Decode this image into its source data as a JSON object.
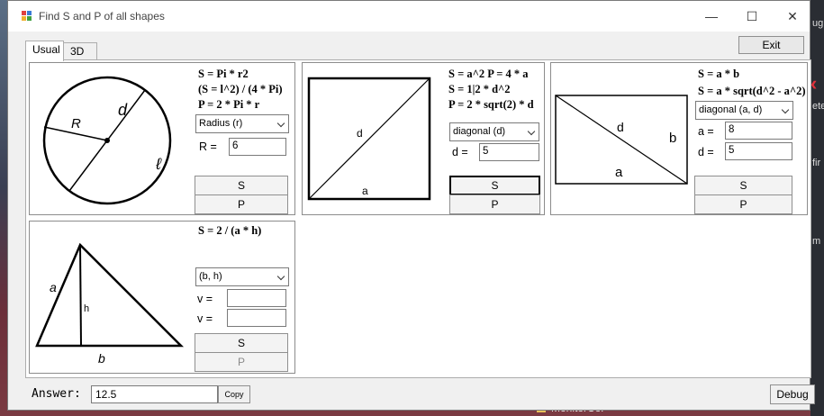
{
  "window": {
    "title": "Find S and P of all shapes",
    "minimize": "—",
    "maximize": "☐",
    "close": "✕"
  },
  "tabs": [
    {
      "label": "Usual",
      "active": true
    },
    {
      "label": "3D",
      "active": false
    }
  ],
  "circle": {
    "formulas": [
      "S = Pi * r2",
      "(S = l^2) / (4 * Pi)",
      "P = 2 * Pi * r"
    ],
    "select": "Radius (r)",
    "fields": [
      {
        "label": "R  =",
        "value": "6"
      }
    ],
    "buttons": [
      "S",
      "P"
    ],
    "diagram_labels": {
      "radius": "R",
      "diameter": "d",
      "perimeter": "ℓ"
    }
  },
  "square": {
    "formulas": [
      "S = a^2   P = 4 * a",
      "S = 1|2 * d^2",
      "P = 2 * sqrt(2) * d"
    ],
    "select": "diagonal (d)",
    "fields": [
      {
        "label": "d  =",
        "value": "5"
      }
    ],
    "buttons": [
      "S",
      "P"
    ],
    "diagram_labels": {
      "diagonal": "d",
      "side": "a"
    }
  },
  "rectangle": {
    "formulas": [
      "S = a * b",
      "S = a * sqrt(d^2 - a^2)"
    ],
    "select": "diagonal (a, d)",
    "fields": [
      {
        "label": "a  =",
        "value": "8"
      },
      {
        "label": "d  =",
        "value": "5"
      }
    ],
    "buttons": [
      "S",
      "P"
    ],
    "diagram_labels": {
      "diagonal": "d",
      "side_b": "b",
      "side_a": "a"
    }
  },
  "triangle": {
    "formulas": [
      "S = 2 / (a * h)"
    ],
    "select": "(b, h)",
    "fields": [
      {
        "label": "v  =",
        "value": ""
      },
      {
        "label": "v  =",
        "value": ""
      }
    ],
    "buttons": [
      "S",
      "P"
    ],
    "diagram_labels": {
      "side_a": "a",
      "height": "h",
      "base": "b"
    }
  },
  "footer": {
    "answer_label": "Answer:",
    "answer_value": "12.5",
    "copy": "Copy",
    "debug": "Debug"
  },
  "background": {
    "taskbar_item": "MonitorCor",
    "right_snippets": [
      "ug",
      "ete",
      "fir",
      "m"
    ]
  }
}
